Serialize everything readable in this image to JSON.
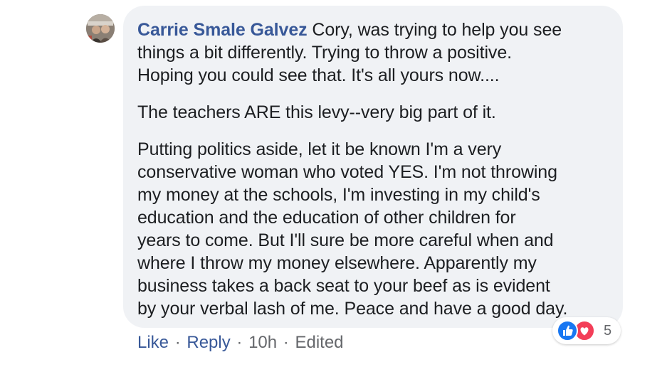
{
  "comment": {
    "author": "Carrie Smale Galvez",
    "paragraphs": [
      {
        "lines": " Cory, was trying to help you see\nthings a bit differently. Trying to throw a positive.\nHoping you could see that. It's all yours now...."
      },
      {
        "lines": "The teachers ARE this levy--very big part of it."
      },
      {
        "lines": "Putting politics aside, let it be known I'm a very\nconservative woman who voted YES. I'm not throwing\nmy money at the schools, I'm investing in my child's\neducation and the education of other children for\nyears to come. But I'll sure be more careful when and\nwhere I throw my money elsewhere. Apparently my\nbusiness takes a back seat to your beef as is evident\nby your verbal lash of me. Peace and have a good day."
      }
    ]
  },
  "actions": {
    "like_label": "Like",
    "reply_label": "Reply",
    "separator": "·",
    "time": "10h",
    "edited_label": "Edited"
  },
  "reactions": {
    "icons": [
      "like-icon",
      "love-icon"
    ],
    "count": "5",
    "colors": {
      "like": "#1877f2",
      "love": "#f33e58"
    }
  },
  "colors": {
    "author_link": "#385898",
    "bubble_bg": "#f0f2f5",
    "meta_gray": "#65676b"
  }
}
